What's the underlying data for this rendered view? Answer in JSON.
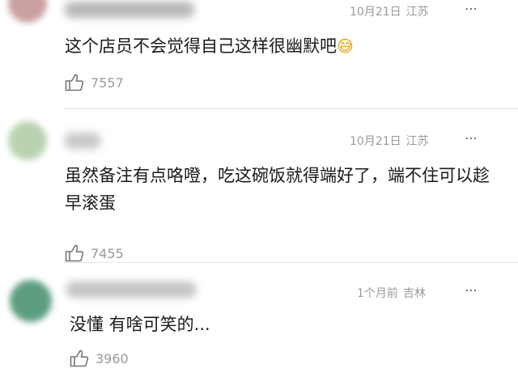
{
  "comments": [
    {
      "avatar_color": "#c9a0a0",
      "time": "10月21日",
      "location": "江苏",
      "more_icon": "more-dots-icon",
      "text": "这个店员不会觉得自己这样很幽默吧",
      "emoji": "😅",
      "likes": "7557"
    },
    {
      "avatar_color": "#b9d3b0",
      "time": "10月21日",
      "location": "江苏",
      "more_icon": "more-dots-icon",
      "text": "虽然备注有点咯噔，吃这碗饭就得端好了，端不住可以趁早滚蛋",
      "likes": "7455"
    },
    {
      "avatar_color": "#5e9e80",
      "time": "1个月前",
      "location": "吉林",
      "more_icon": "more-dots-icon",
      "text": "没懂 有啥可笑的...",
      "likes": "3960"
    }
  ],
  "more_label": "⋯",
  "like_icon": "thumbs-up-icon"
}
